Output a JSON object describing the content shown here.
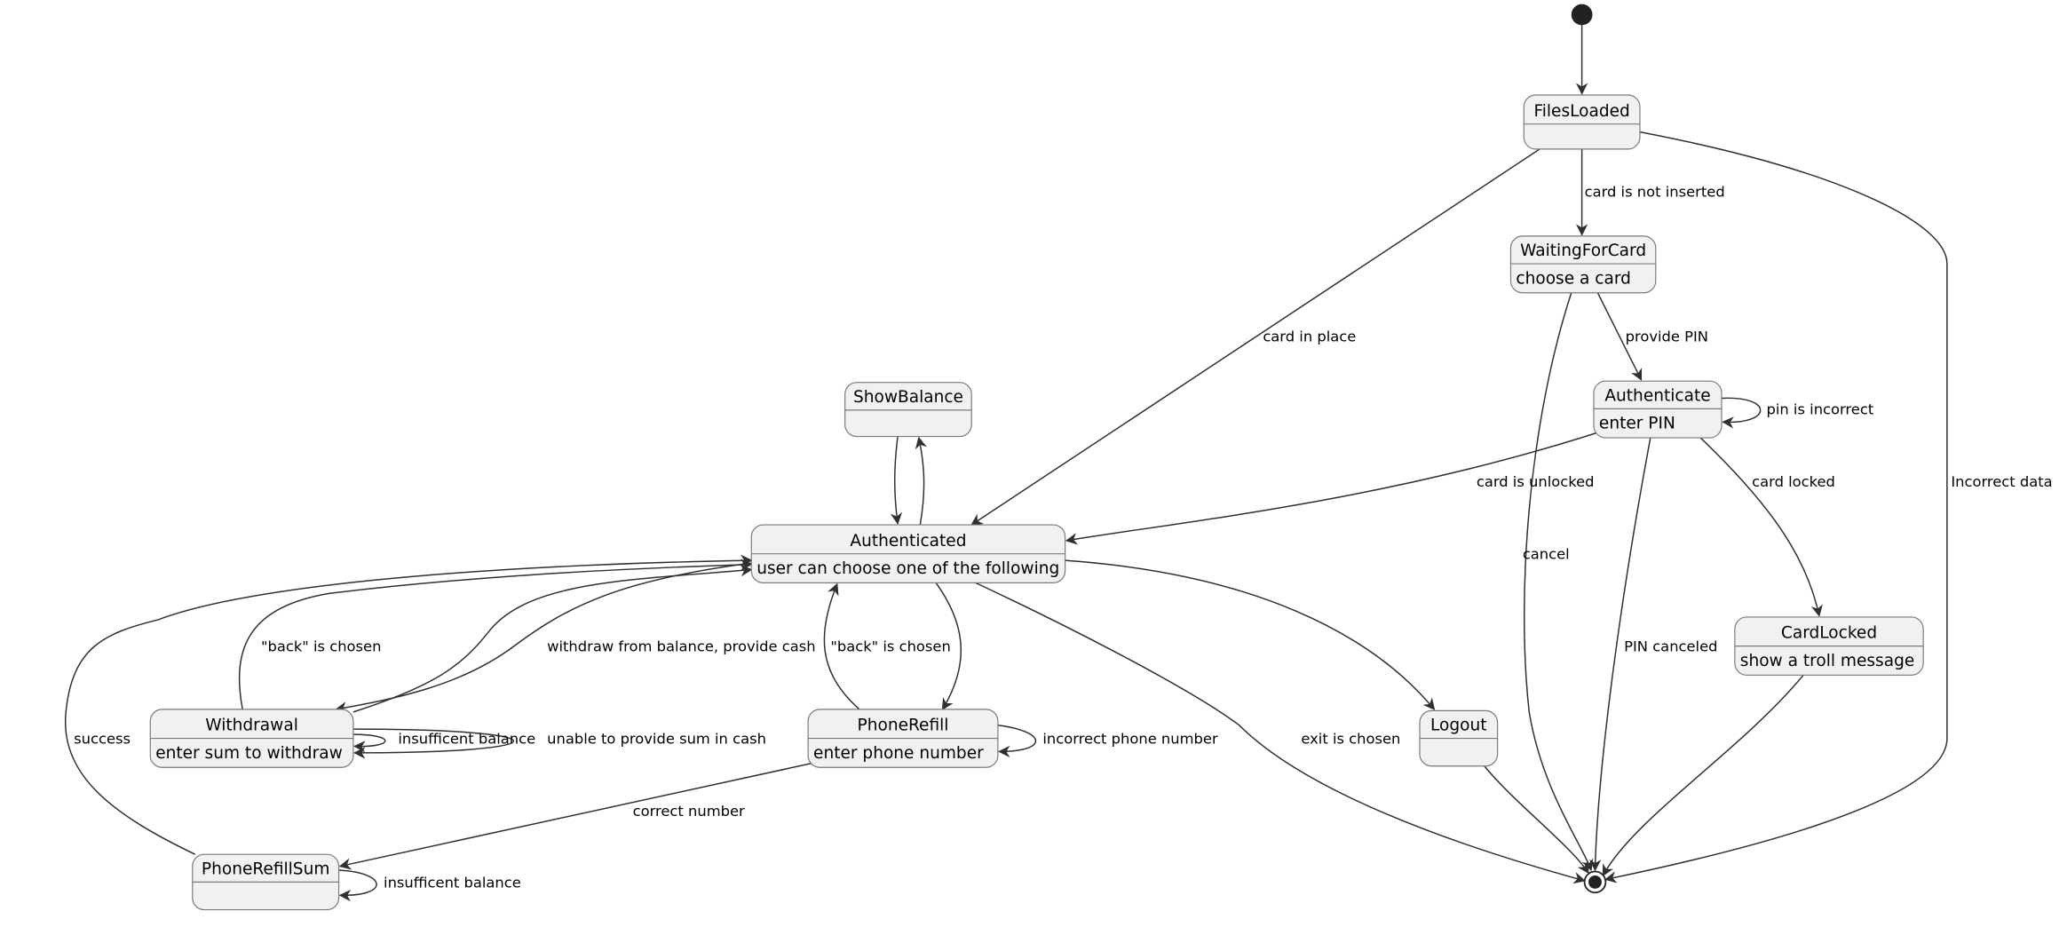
{
  "states": [
    {
      "id": "FilesLoaded",
      "title": "FilesLoaded",
      "description": ""
    },
    {
      "id": "WaitingForCard",
      "title": "WaitingForCard",
      "description": "choose a card"
    },
    {
      "id": "Authenticate",
      "title": "Authenticate",
      "description": "enter PIN"
    },
    {
      "id": "ShowBalance",
      "title": "ShowBalance",
      "description": ""
    },
    {
      "id": "Authenticated",
      "title": "Authenticated",
      "description": "user can choose one of the following"
    },
    {
      "id": "CardLocked",
      "title": "CardLocked",
      "description": "show a troll message"
    },
    {
      "id": "Withdrawal",
      "title": "Withdrawal",
      "description": "enter sum to withdraw"
    },
    {
      "id": "PhoneRefill",
      "title": "PhoneRefill",
      "description": "enter phone number"
    },
    {
      "id": "Logout",
      "title": "Logout",
      "description": ""
    },
    {
      "id": "PhoneRefillSum",
      "title": "PhoneRefillSum",
      "description": ""
    }
  ],
  "transitions": [
    {
      "from": "start",
      "to": "FilesLoaded",
      "label": ""
    },
    {
      "from": "FilesLoaded",
      "to": "WaitingForCard",
      "label": "card is not inserted"
    },
    {
      "from": "FilesLoaded",
      "to": "Authenticated",
      "label": "card in place"
    },
    {
      "from": "FilesLoaded",
      "to": "end",
      "label": "Incorrect data"
    },
    {
      "from": "WaitingForCard",
      "to": "Authenticate",
      "label": "provide PIN"
    },
    {
      "from": "WaitingForCard",
      "to": "end",
      "label": "cancel"
    },
    {
      "from": "Authenticate",
      "to": "Authenticate",
      "label": "pin is incorrect"
    },
    {
      "from": "Authenticate",
      "to": "Authenticated",
      "label": "card is unlocked"
    },
    {
      "from": "Authenticate",
      "to": "end",
      "label": "PIN canceled"
    },
    {
      "from": "Authenticate",
      "to": "CardLocked",
      "label": "card locked"
    },
    {
      "from": "CardLocked",
      "to": "end",
      "label": ""
    },
    {
      "from": "Logout",
      "to": "end",
      "label": ""
    },
    {
      "from": "Authenticated",
      "to": "Logout",
      "label": ""
    },
    {
      "from": "Authenticated",
      "to": "end",
      "label": "exit is chosen"
    },
    {
      "from": "ShowBalance",
      "to": "Authenticated",
      "label": ""
    },
    {
      "from": "Authenticated",
      "to": "ShowBalance",
      "label": ""
    },
    {
      "from": "Authenticated",
      "to": "Withdrawal",
      "label": ""
    },
    {
      "from": "Withdrawal",
      "to": "Authenticated",
      "label": "withdraw from balance, provide cash"
    },
    {
      "from": "Withdrawal",
      "to": "Authenticated",
      "label": "\"back\" is chosen"
    },
    {
      "from": "PhoneRefillSum",
      "to": "Authenticated",
      "label": "success"
    },
    {
      "from": "Withdrawal",
      "to": "Withdrawal",
      "label": "insufficent balance"
    },
    {
      "from": "Withdrawal",
      "to": "Withdrawal",
      "label": "unable to provide sum in cash"
    },
    {
      "from": "Authenticated",
      "to": "PhoneRefill",
      "label": ""
    },
    {
      "from": "PhoneRefill",
      "to": "Authenticated",
      "label": "\"back\" is chosen"
    },
    {
      "from": "PhoneRefill",
      "to": "PhoneRefill",
      "label": "incorrect phone number"
    },
    {
      "from": "PhoneRefill",
      "to": "PhoneRefillSum",
      "label": "correct number"
    },
    {
      "from": "PhoneRefillSum",
      "to": "PhoneRefillSum",
      "label": "insufficent balance"
    }
  ],
  "colors": {
    "state_fill": "#f1f1f1",
    "line": "#303030",
    "node": "#222222"
  }
}
